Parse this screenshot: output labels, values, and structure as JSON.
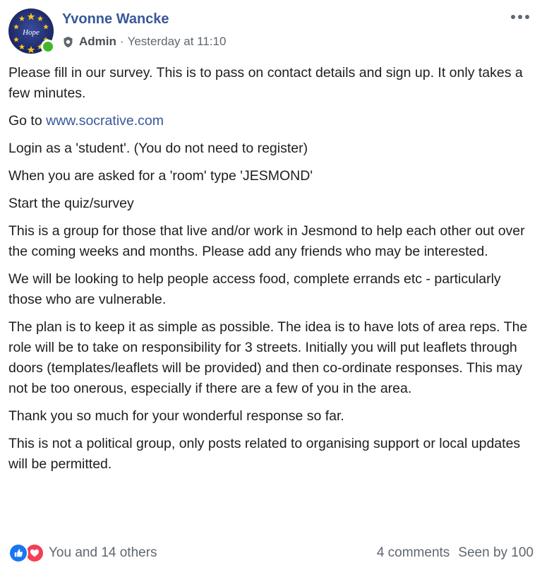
{
  "post": {
    "author": "Yvonne Wancke",
    "avatar_text": "Hope",
    "role": "Admin",
    "separator": "·",
    "timestamp": "Yesterday at 11:10",
    "more_glyph": "•••",
    "paragraphs": {
      "p1": "Please fill in our survey. This is to pass on contact details and sign up. It only takes a few minutes.",
      "p2_prefix": "Go to ",
      "p2_link": "www.socrative.com",
      "p3": "Login as a 'student'. (You do not need to register)",
      "p4": "When you are asked for a 'room' type 'JESMOND'",
      "p5": "Start the quiz/survey",
      "p6": "This is a group for those that live and/or work in Jesmond to help each other out over the coming weeks and months. Please add any friends who may be interested.",
      "p7": "We will be looking to help people access food, complete errands etc - particularly those who are vulnerable.",
      "p8": "The plan is to keep it as simple as possible. The idea is to have lots of area reps. The role will be to take on responsibility for 3 streets. Initially you will put leaflets through doors (templates/leaflets will be provided) and then co-ordinate responses. This may not be too onerous, especially if there are a few of you in the area.",
      "p9": "Thank you so much for your wonderful response so far.",
      "p10": "This is not a political group, only posts related to organising support or local updates will be permitted."
    },
    "footer": {
      "reactions_text": "You and 14 others",
      "comments": "4 comments",
      "seen": "Seen by 100"
    },
    "icons": {
      "avatar": "hope-avatar",
      "online": "online-status-dot",
      "role": "admin-shield-icon",
      "more": "more-options-icon",
      "like": "like-reaction-icon",
      "love": "love-reaction-icon"
    },
    "colors": {
      "link": "#385898",
      "meta": "#606770",
      "online": "#42b72a",
      "like": "#1877f2",
      "love": "#f33e58",
      "avatar_bg": "#1e2a6e",
      "avatar_star": "#f5c518"
    }
  }
}
